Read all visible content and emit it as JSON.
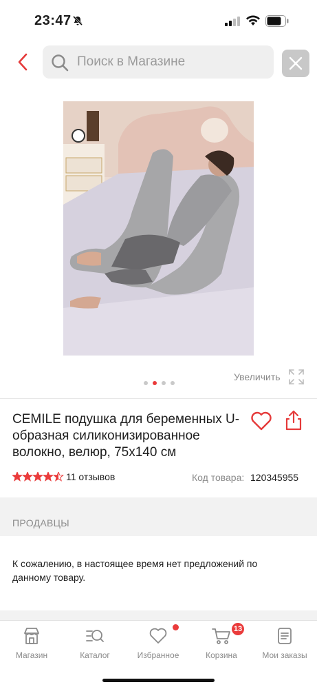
{
  "status_bar": {
    "time": "23:47",
    "icons": [
      "bell-slash-icon",
      "signal-icon",
      "wifi-icon",
      "battery-icon"
    ]
  },
  "header": {
    "back_icon": "chevron-left-icon",
    "search_placeholder": "Поиск в Магазине",
    "clear_icon": "close-icon"
  },
  "gallery": {
    "image_alt": "product-photo",
    "page_count": 4,
    "active_page": 2,
    "zoom_label": "Увеличить",
    "zoom_icon": "expand-icon"
  },
  "product": {
    "title": "CEMILE подушка для беременных U-образная силиконизированное волокно, велюр, 75х140 см",
    "rating": 4.5,
    "reviews_label": "11 отзывов",
    "code_label": "Код товара:",
    "code_value": "120345955",
    "favorite_icon": "heart-icon",
    "share_icon": "share-icon"
  },
  "sellers": {
    "section_title": "ПРОДАВЦЫ",
    "empty_message": "К сожалению, в настоящее время нет предложений по данному товару."
  },
  "tab_bar": {
    "items": [
      {
        "label": "Магазин",
        "icon": "store-icon"
      },
      {
        "label": "Каталог",
        "icon": "catalog-search-icon"
      },
      {
        "label": "Избранное",
        "icon": "heart-icon"
      },
      {
        "label": "Корзина",
        "icon": "cart-icon"
      },
      {
        "label": "Мои заказы",
        "icon": "orders-icon"
      }
    ],
    "cart_badge": "13"
  },
  "colors": {
    "accent": "#ea3b3b",
    "muted_text": "#8a8a8a",
    "section_bg": "#f2f2f2"
  }
}
